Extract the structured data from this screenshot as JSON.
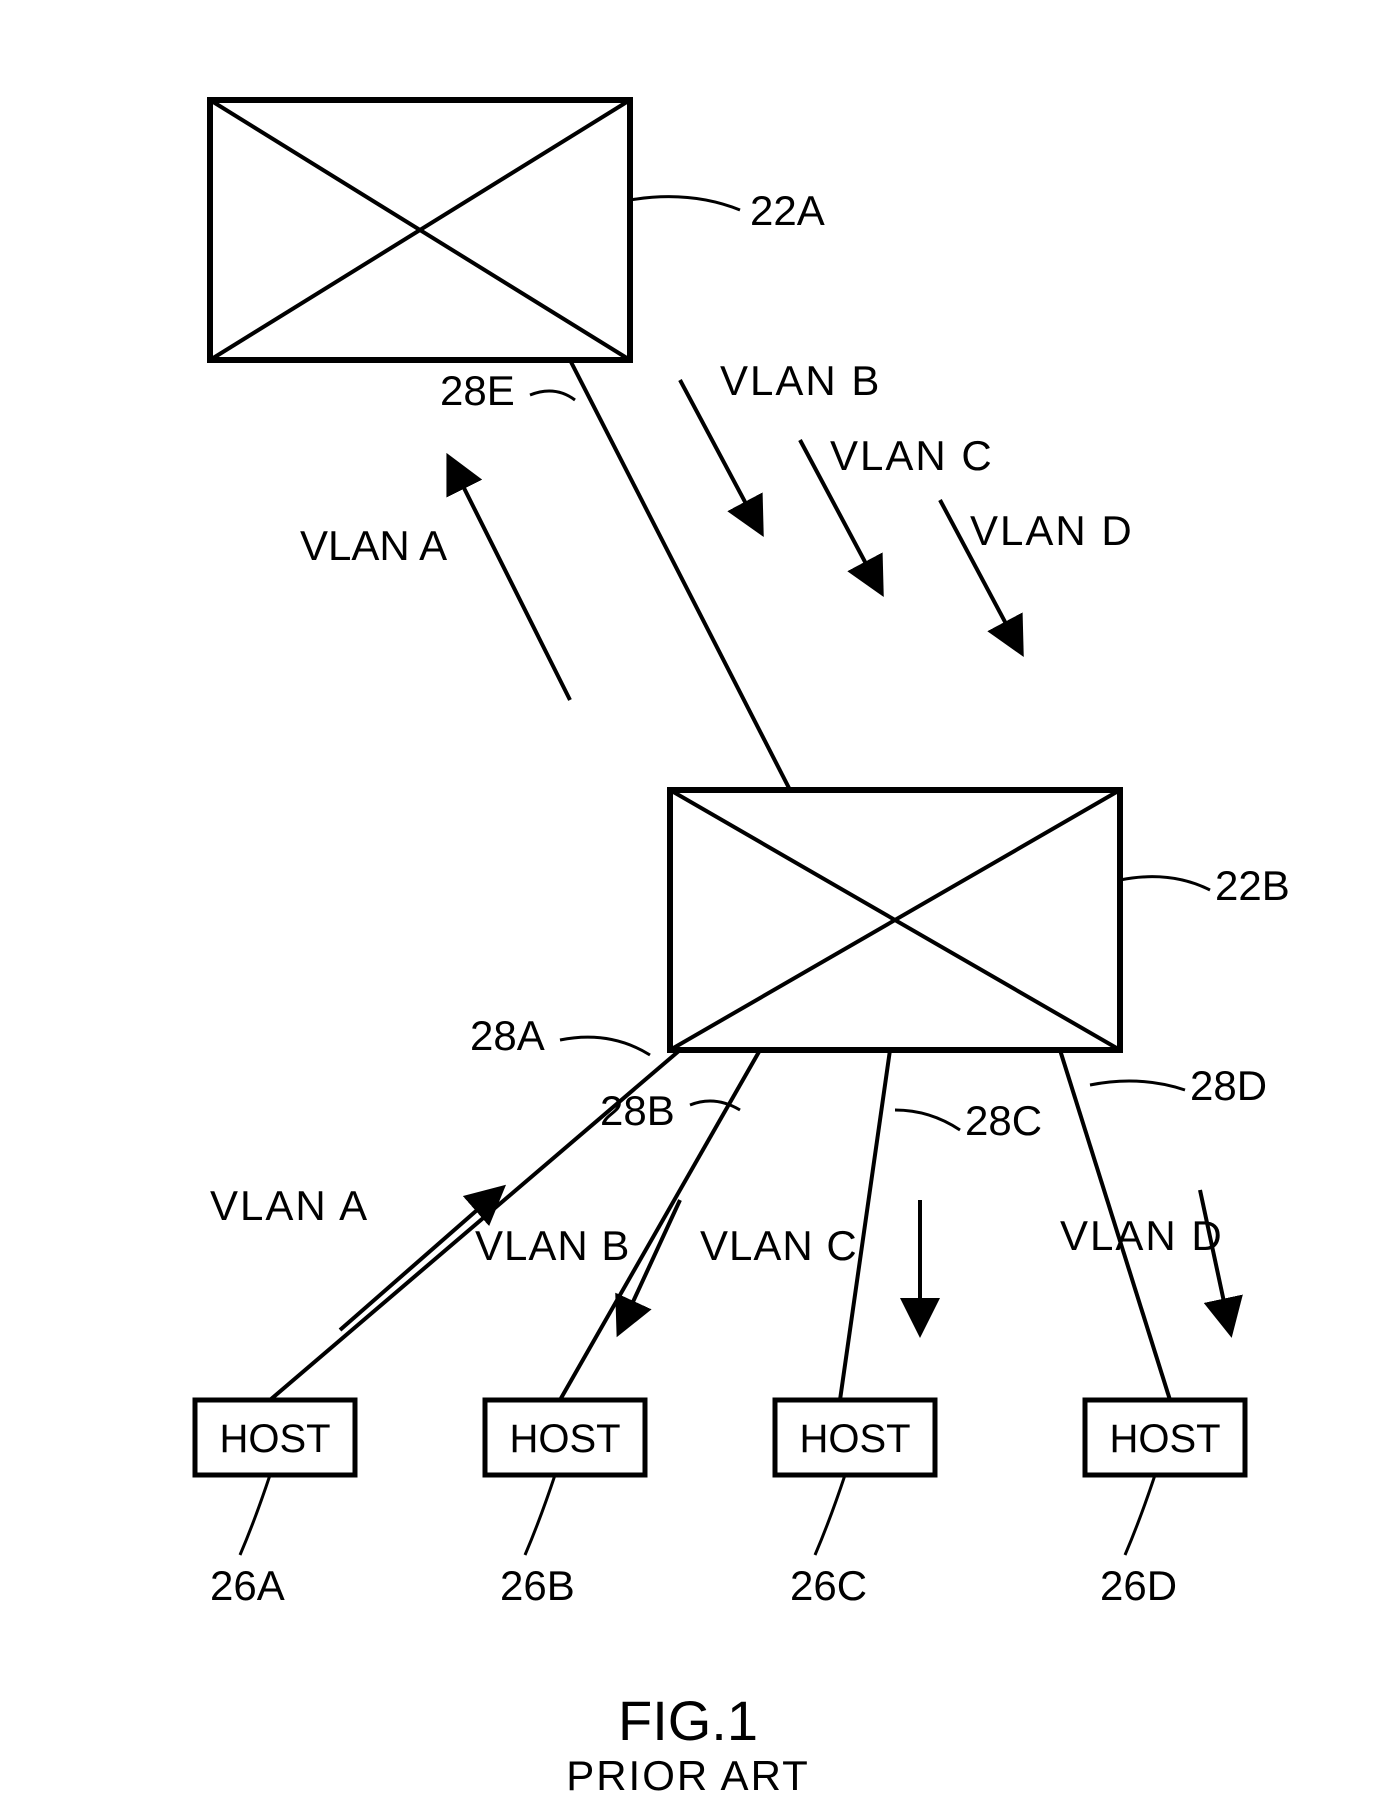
{
  "figure": {
    "title": "FIG.1",
    "subtitle": "PRIOR ART"
  },
  "switches": {
    "top": {
      "ref": "22A"
    },
    "bottom": {
      "ref": "22B"
    }
  },
  "hosts": {
    "a": {
      "label": "HOST",
      "ref": "26A"
    },
    "b": {
      "label": "HOST",
      "ref": "26B"
    },
    "c": {
      "label": "HOST",
      "ref": "26C"
    },
    "d": {
      "label": "HOST",
      "ref": "26D"
    }
  },
  "links": {
    "e": {
      "ref": "28E"
    },
    "a": {
      "ref": "28A"
    },
    "b": {
      "ref": "28B"
    },
    "c": {
      "ref": "28C"
    },
    "d": {
      "ref": "28D"
    }
  },
  "vlans": {
    "top": {
      "a": "VLAN A",
      "b": "VLAN B",
      "c": "VLAN C",
      "d": "VLAN D"
    },
    "bottom": {
      "a": "VLAN A",
      "b": "VLAN B",
      "c": "VLAN C",
      "d": "VLAN D"
    }
  }
}
